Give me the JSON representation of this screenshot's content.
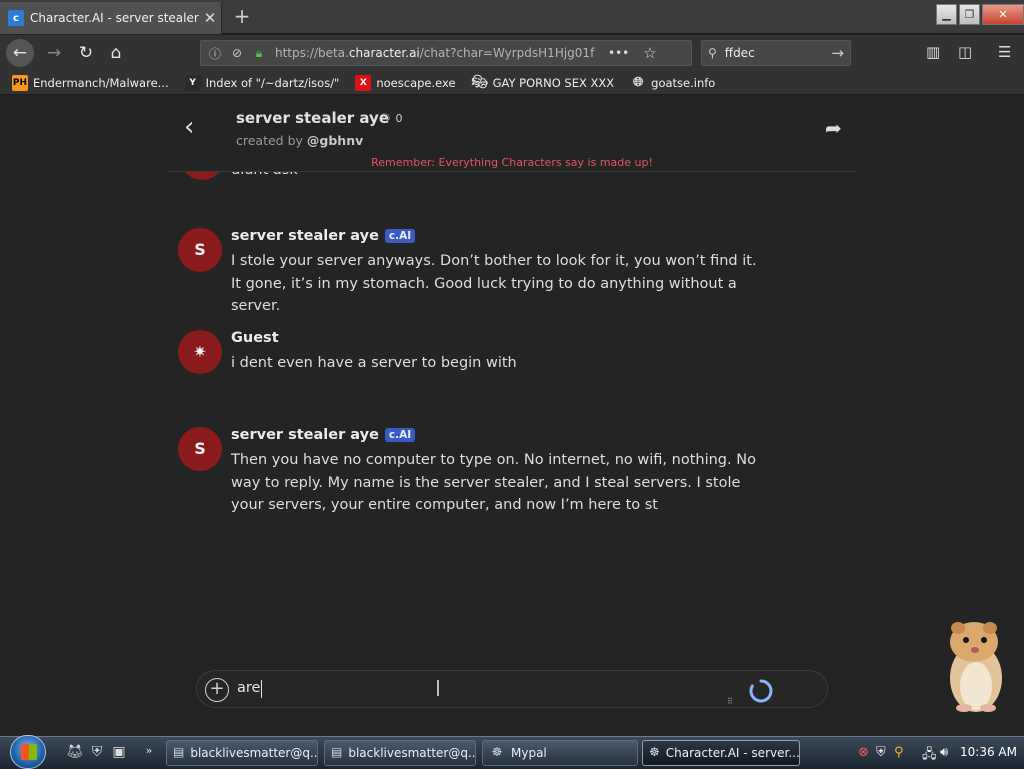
{
  "browser": {
    "tab_title": "Character.AI - server stealer aye",
    "tab_favicon": "character-ai-favicon",
    "url_prefix": "https://beta.",
    "url_domain": "character.ai",
    "url_rest": "/chat?char=WyrpdsH1Hjg01f",
    "search_value": "ffdec",
    "icons": [
      "back-icon",
      "forward-icon",
      "reload-icon",
      "home-icon",
      "info-icon",
      "permissions-icon",
      "lock-icon",
      "page-actions-icon",
      "bookmark-star-icon",
      "search-icon",
      "go-arrow-icon",
      "library-icon",
      "sidebar-icon",
      "menu-icon"
    ]
  },
  "bookmarks": [
    {
      "label": "Endermanch/Malware...",
      "icon": "PH"
    },
    {
      "label": "Index of \"/~dartz/isos/\"",
      "icon": "Y"
    },
    {
      "label": "noescape.exe",
      "icon": "X"
    },
    {
      "label": "GAY PORNO SEX XXX",
      "icon": "mask-icon"
    },
    {
      "label": "goatse.info",
      "icon": "globe-icon"
    }
  ],
  "chat": {
    "character_name": "server stealer aye",
    "chat_count": "0",
    "creator_prefix": "created by",
    "creator": "@gbhnv",
    "disclaimer": "Remember: Everything Characters say is made up!",
    "partial_text": "didnt ask",
    "messages": [
      {
        "avatar": "S",
        "name": "server stealer aye",
        "badge": "c.AI",
        "text": "I stole your server anyways. Don’t bother to look for it, you won’t find it. It gone, it’s in my stomach. Good luck trying to do anything without a server."
      },
      {
        "avatar": "✷",
        "name": "Guest",
        "badge": "",
        "text": "i dent even have a server to begin with"
      },
      {
        "avatar": "S",
        "name": "server stealer aye",
        "badge": "c.AI",
        "text": "Then you have no computer to type on. No internet, no wifi, nothing. No way to reply. My name is the server stealer, and I steal servers. I stole your servers, your entire computer, and now I’m here to st"
      }
    ],
    "input_value": "are",
    "accent_color": "#8b1a1a",
    "badge_color": "#3b5bc4",
    "disclaimer_color": "#e05563"
  },
  "taskbar": {
    "buttons": [
      {
        "label": "blacklivesmatter@q..."
      },
      {
        "label": "blacklivesmatter@q..."
      },
      {
        "label": "Mypal"
      },
      {
        "label": "Character.AI - server..."
      }
    ],
    "clock": "10:36 AM"
  }
}
